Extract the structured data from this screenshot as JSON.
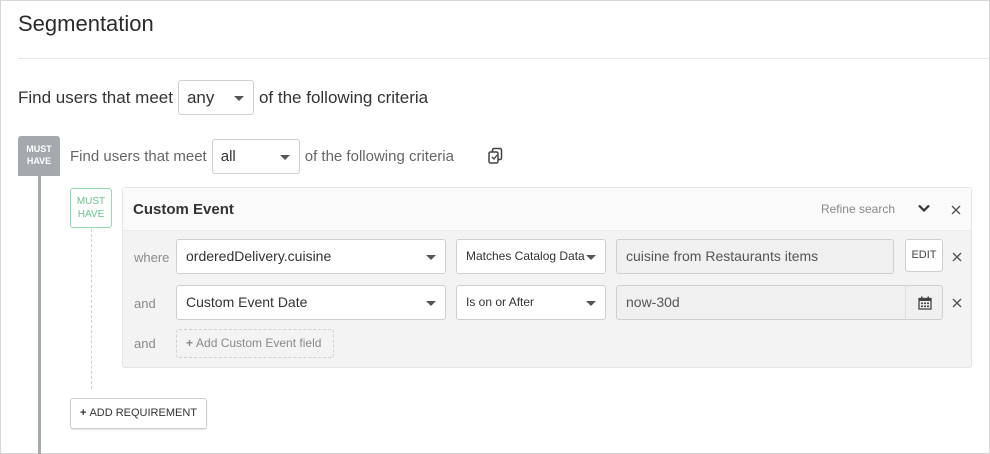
{
  "page": {
    "title": "Segmentation"
  },
  "top_criteria": {
    "prefix": "Find users that meet",
    "match_value": "any",
    "suffix": "of the following criteria"
  },
  "group": {
    "badge": "MUST HAVE",
    "prefix": "Find users that meet",
    "match_value": "all",
    "suffix": "of the following criteria",
    "copy_icon": "copy-icon"
  },
  "requirement": {
    "badge": "MUST HAVE",
    "title": "Custom Event",
    "refine_label": "Refine search",
    "rows": [
      {
        "label": "where",
        "field": "orderedDelivery.cuisine",
        "operator": "Matches Catalog Data",
        "value": "cuisine from Restaurants items",
        "action": "EDIT"
      },
      {
        "label": "and",
        "field": "Custom Event Date",
        "operator": "Is on or After",
        "value": "now-30d",
        "action_icon": "calendar-icon"
      }
    ],
    "add_row": {
      "label": "and",
      "button": "Add Custom Event field"
    }
  },
  "add_requirement_button": "ADD REQUIREMENT",
  "colors": {
    "badge_gray": "#a3a9ad",
    "badge_green": "#6ac28c",
    "panel_bg": "#f3f3f3"
  }
}
